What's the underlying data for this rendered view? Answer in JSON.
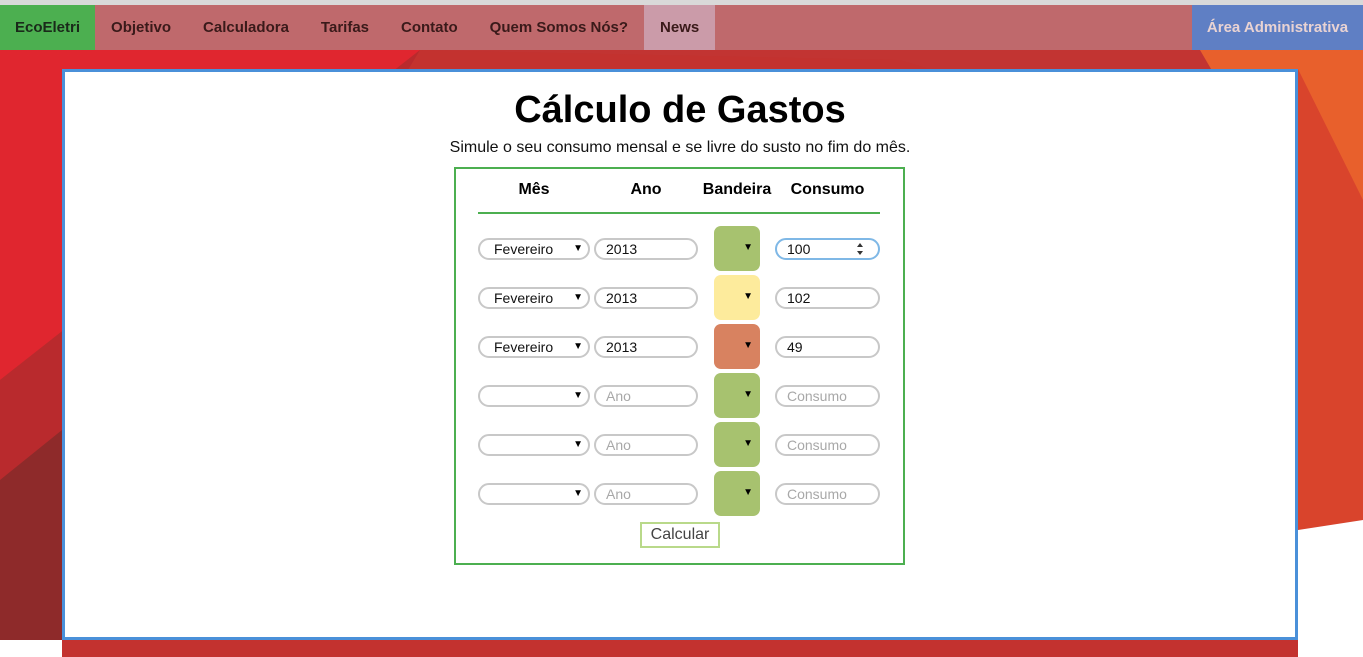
{
  "nav": {
    "brand": "EcoEletri",
    "items": [
      "Objetivo",
      "Calculadora",
      "Tarifas",
      "Contato",
      "Quem Somos Nós?",
      "News"
    ],
    "active": "News",
    "admin": "Área Administrativa"
  },
  "page": {
    "title": "Cálculo de Gastos",
    "subtitle": "Simule o seu consumo mensal e se livre do susto no fim do mês."
  },
  "form": {
    "headers": {
      "mes": "Mês",
      "ano": "Ano",
      "bandeira": "Bandeira",
      "consumo": "Consumo"
    },
    "placeholders": {
      "ano": "Ano",
      "consumo": "Consumo"
    },
    "rows": [
      {
        "mes": "Fevereiro",
        "ano": "2013",
        "bandeira": "green",
        "consumo": "100"
      },
      {
        "mes": "Fevereiro",
        "ano": "2013",
        "bandeira": "yellow",
        "consumo": "102"
      },
      {
        "mes": "Fevereiro",
        "ano": "2013",
        "bandeira": "red",
        "consumo": "49"
      },
      {
        "mes": "",
        "ano": "",
        "bandeira": "green",
        "consumo": ""
      },
      {
        "mes": "",
        "ano": "",
        "bandeira": "green",
        "consumo": ""
      },
      {
        "mes": "",
        "ano": "",
        "bandeira": "green",
        "consumo": ""
      }
    ],
    "submit": "Calcular"
  },
  "colors": {
    "green": "#a7c26f",
    "yellow": "#fdeb9c",
    "red": "#d88260",
    "accent_blue": "#4a90d9",
    "accent_green": "#4caf50"
  }
}
